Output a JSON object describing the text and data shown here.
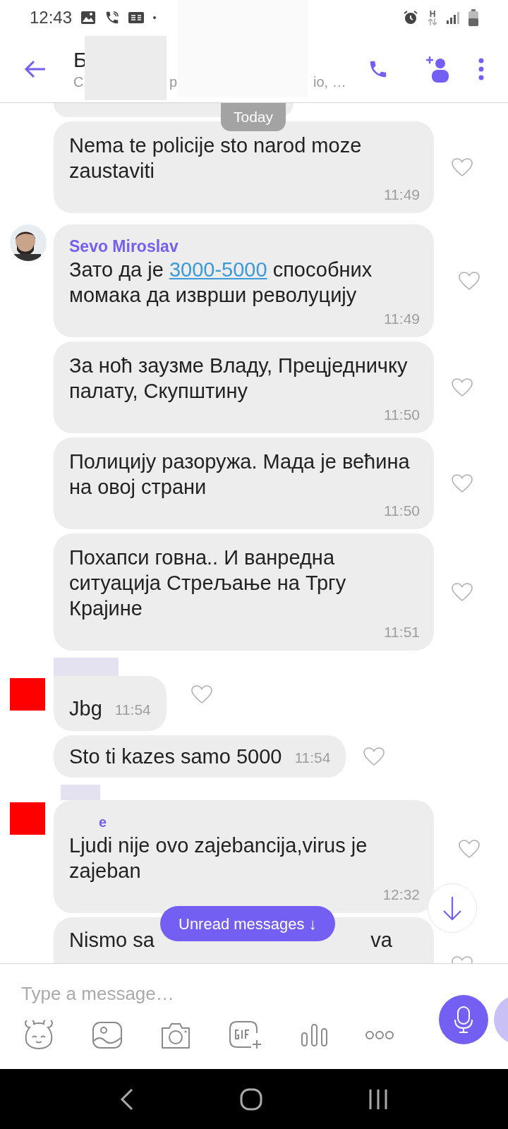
{
  "status_bar": {
    "time": "12:43",
    "network_type": "H"
  },
  "header": {
    "title": "Б",
    "subtitle_parts": [
      "С",
      "р",
      "io, …"
    ]
  },
  "date_pill": "Today",
  "messages": [
    {
      "kind": "fragment"
    },
    {
      "kind": "text",
      "parts": [
        {
          "text": "Nema te policije sto narod moze zaustaviti"
        }
      ],
      "time": "11:49"
    },
    {
      "kind": "text",
      "avatar": {
        "kind": "photo"
      },
      "sender": "Sevo Miroslav",
      "parts": [
        {
          "text": "Зато да је "
        },
        {
          "text": "3000-5000",
          "link": true
        },
        {
          "text": " способних момака да изврши револуцију"
        }
      ],
      "time": "11:49"
    },
    {
      "kind": "text",
      "parts": [
        {
          "text": "За ноћ заузме Владу, Прецједничку палату, Скупштину"
        }
      ],
      "time": "11:50"
    },
    {
      "kind": "text",
      "parts": [
        {
          "text": "Полицију разоружа. Мада је већина на овој страни"
        }
      ],
      "time": "11:50"
    },
    {
      "kind": "text",
      "parts": [
        {
          "text": "Похапси говна.. И ванредна ситуација Стрељање на Тргу Крајине"
        }
      ],
      "time": "11:51"
    },
    {
      "kind": "short",
      "avatar": {
        "kind": "redacted"
      },
      "sender_redacted": true,
      "parts": [
        {
          "text": "Jbg"
        }
      ],
      "time": "11:54"
    },
    {
      "kind": "short",
      "parts": [
        {
          "text": "Sto ti kazes samo 5000"
        }
      ],
      "time": "11:54"
    },
    {
      "kind": "text",
      "avatar": {
        "kind": "redacted"
      },
      "sender_redacted": true,
      "sender": "e",
      "parts": [
        {
          "text": "Ljudi nije ovo zajebancija,virus je zajeban"
        }
      ],
      "time": "12:32"
    },
    {
      "kind": "covered",
      "line_start": "Nismo sa",
      "line_end": "va"
    }
  ],
  "unread_pill": "Unread messages ↓",
  "composer": {
    "placeholder": "Type a message…"
  }
}
